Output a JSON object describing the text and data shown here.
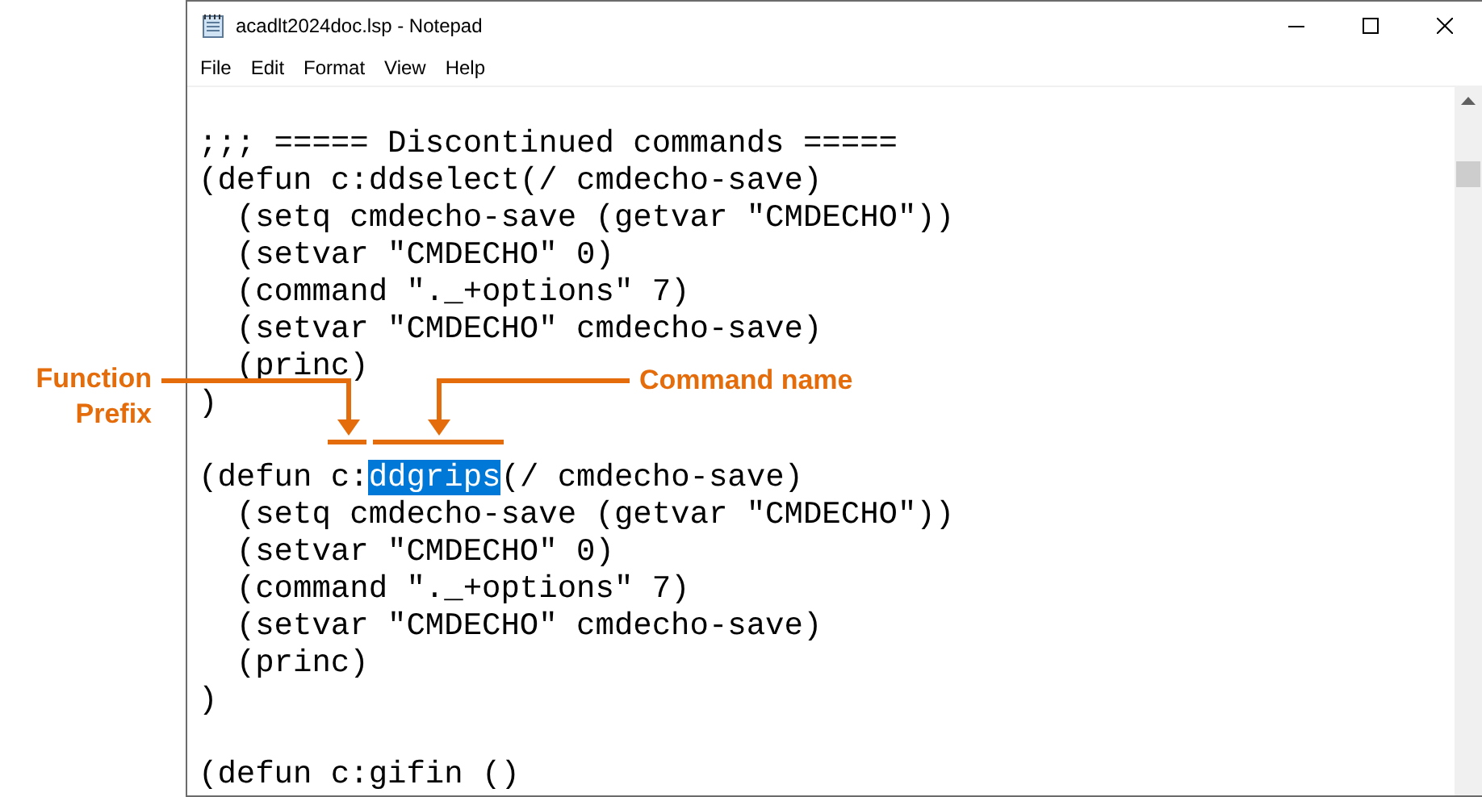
{
  "window": {
    "title": "acadlt2024doc.lsp - Notepad"
  },
  "menu": [
    "File",
    "Edit",
    "Format",
    "View",
    "Help"
  ],
  "lines": [
    {
      "kind": "blank"
    },
    {
      "kind": "code",
      "segments": [
        {
          "text": ";;; ===== Discontinued commands =====",
          "selected": false
        }
      ]
    },
    {
      "kind": "code",
      "segments": [
        {
          "text": "(defun c:ddselect(/ cmdecho-save)",
          "selected": false
        }
      ]
    },
    {
      "kind": "code",
      "segments": [
        {
          "text": "  (setq cmdecho-save (getvar \"CMDECHO\"))",
          "selected": false
        }
      ]
    },
    {
      "kind": "code",
      "segments": [
        {
          "text": "  (setvar \"CMDECHO\" 0)",
          "selected": false
        }
      ]
    },
    {
      "kind": "code",
      "segments": [
        {
          "text": "  (command \"._+options\" 7)",
          "selected": false
        }
      ]
    },
    {
      "kind": "code",
      "segments": [
        {
          "text": "  (setvar \"CMDECHO\" cmdecho-save)",
          "selected": false
        }
      ]
    },
    {
      "kind": "code",
      "segments": [
        {
          "text": "  (princ)",
          "selected": false
        }
      ]
    },
    {
      "kind": "code",
      "segments": [
        {
          "text": ")",
          "selected": false
        }
      ]
    },
    {
      "kind": "blank"
    },
    {
      "kind": "code",
      "segments": [
        {
          "text": "(defun c:",
          "selected": false
        },
        {
          "text": "ddgrips",
          "selected": true
        },
        {
          "text": "(/ cmdecho-save)",
          "selected": false
        }
      ]
    },
    {
      "kind": "code",
      "segments": [
        {
          "text": "  (setq cmdecho-save (getvar \"CMDECHO\"))",
          "selected": false
        }
      ]
    },
    {
      "kind": "code",
      "segments": [
        {
          "text": "  (setvar \"CMDECHO\" 0)",
          "selected": false
        }
      ]
    },
    {
      "kind": "code",
      "segments": [
        {
          "text": "  (command \"._+options\" 7)",
          "selected": false
        }
      ]
    },
    {
      "kind": "code",
      "segments": [
        {
          "text": "  (setvar \"CMDECHO\" cmdecho-save)",
          "selected": false
        }
      ]
    },
    {
      "kind": "code",
      "segments": [
        {
          "text": "  (princ)",
          "selected": false
        }
      ]
    },
    {
      "kind": "code",
      "segments": [
        {
          "text": ")",
          "selected": false
        }
      ]
    },
    {
      "kind": "blank"
    },
    {
      "kind": "code",
      "segments": [
        {
          "text": "(defun c:gifin ()",
          "selected": false
        }
      ]
    }
  ],
  "annotations": [
    {
      "label": "Function Prefix"
    },
    {
      "label": "Command name"
    }
  ]
}
